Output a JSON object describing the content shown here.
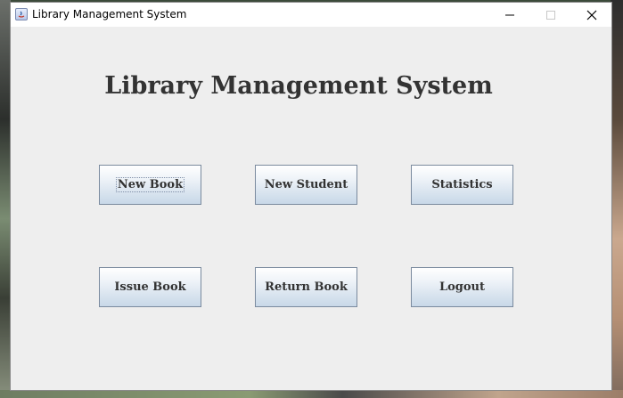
{
  "window": {
    "title": "Library Management System",
    "controls": {
      "minimize": "minimize-icon",
      "maximize": "maximize-icon",
      "close": "close-icon"
    }
  },
  "main": {
    "heading": "Library Management System",
    "buttons": [
      {
        "label": "New Book",
        "focused": true
      },
      {
        "label": "New Student",
        "focused": false
      },
      {
        "label": "Statistics",
        "focused": false
      },
      {
        "label": "Issue Book",
        "focused": false
      },
      {
        "label": "Return Book",
        "focused": false
      },
      {
        "label": "Logout",
        "focused": false
      }
    ]
  },
  "colors": {
    "window_bg": "#eeeeee",
    "title_text": "#333333",
    "button_gradient_top": "#ffffff",
    "button_gradient_bottom": "#c8d8e8",
    "button_border": "#7a8a9e"
  }
}
